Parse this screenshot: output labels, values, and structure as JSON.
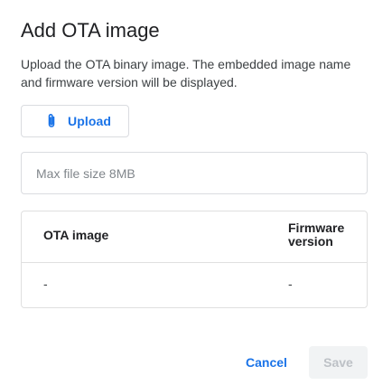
{
  "dialog": {
    "title": "Add OTA image",
    "description": "Upload the OTA binary image. The embedded image name and firmware version will be displayed."
  },
  "upload": {
    "label": "Upload",
    "icon": "paperclip-icon"
  },
  "file_field": {
    "placeholder": "Max file size 8MB"
  },
  "table": {
    "headers": [
      "OTA image",
      "Firmware version"
    ],
    "rows": [
      [
        "-",
        "-"
      ]
    ]
  },
  "actions": {
    "cancel_label": "Cancel",
    "save_label": "Save",
    "save_enabled": false
  },
  "colors": {
    "accent": "#1a73e8",
    "disabled_text": "#bdc1c6",
    "disabled_bg": "#f1f3f4"
  }
}
